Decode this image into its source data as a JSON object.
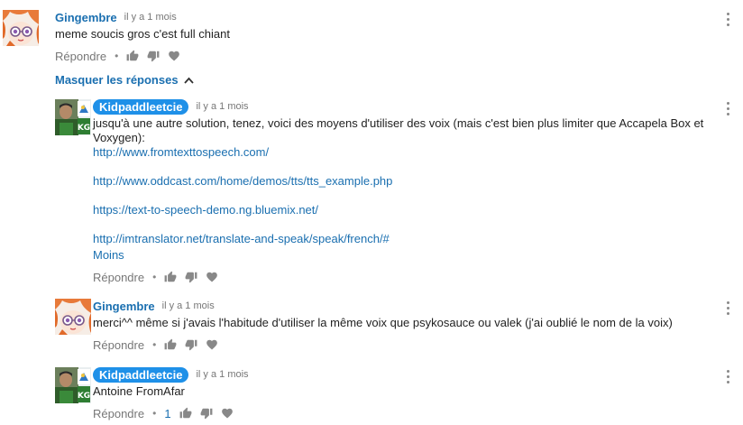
{
  "actions": {
    "reply_label": "Répondre",
    "dot": "•"
  },
  "replies_toggle": "Masquer les réponses",
  "comments": [
    {
      "author": "Gingembre",
      "time": "il y a 1 mois",
      "text": "meme soucis gros c'est full chiant"
    },
    {
      "author": "Kidpaddleetcie",
      "time": "il y a 1 mois",
      "text": "jusqu'à une autre solution, tenez, voici des moyens d'utiliser des voix (mais c'est bien plus limiter que Accapela Box et Voxygen):",
      "links": [
        "http://www.fromtexttospeech.com/",
        "http://www.oddcast.com/home/demos/tts/tts_example.php",
        "https://text-to-speech-demo.ng.bluemix.net/",
        "http://imtranslator.net/translate-and-speak/speak/french/#"
      ],
      "less_label": "Moins"
    },
    {
      "author": "Gingembre",
      "time": "il y a 1 mois",
      "text": "merci^^ même si j'avais l'habitude d'utiliser la même voix que psykosauce ou valek (j'ai oublié le nom de la voix)"
    },
    {
      "author": "Kidpaddleetcie",
      "time": "il y a 1 mois",
      "text": "Antoine FromAfar",
      "like_count": "1"
    }
  ],
  "icons": {
    "like": "thumbs-up-icon",
    "dislike": "thumbs-down-icon",
    "heart": "heart-icon",
    "menu": "more-vert-icon"
  }
}
